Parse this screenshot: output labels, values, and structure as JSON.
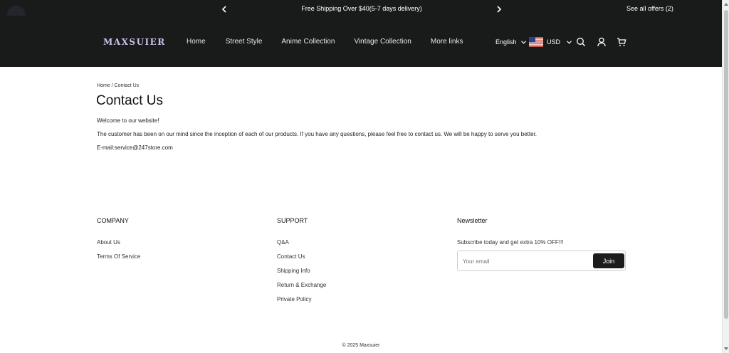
{
  "announcement": {
    "text": "Free Shipping Over $40(5-7 days delivery)",
    "offers_link": "See all offers (2)"
  },
  "header": {
    "logo": "MAXSUIER",
    "nav": [
      "Home",
      "Street Style",
      "Anime Collection",
      "Vintage Collection",
      "More links"
    ],
    "language": "English",
    "currency": "USD",
    "icons": [
      "search-icon",
      "account-icon",
      "cart-icon"
    ]
  },
  "breadcrumb": {
    "home": "Home",
    "separator": " / ",
    "current": "Contact Us"
  },
  "main": {
    "title": "Contact Us",
    "welcome": "Welcome to our website!",
    "body": "The customer has been on our mind since the inception of each of our products. If you have any questions, please feel free to contact us. We will be happy to serve you better.",
    "email": "E-mail:service@247store.com"
  },
  "footer": {
    "company": {
      "heading": "COMPANY",
      "links": [
        "About Us",
        "Terms Of Service"
      ]
    },
    "support": {
      "heading": "SUPPORT",
      "links": [
        "Q&A",
        "Contact Us",
        "Shipping Info",
        "Return & Exchange",
        "Private Policy"
      ]
    },
    "newsletter": {
      "heading": "Newsletter",
      "text": "Subscribe today and get extra 10% OFF!!!",
      "placeholder": "Your email",
      "button": "Join"
    },
    "copyright": "© 2025 Maxsuier"
  },
  "colors": {
    "header_bg": "#191b1a",
    "logo": "#c9bfe6",
    "button_bg": "#1b1c1b"
  }
}
